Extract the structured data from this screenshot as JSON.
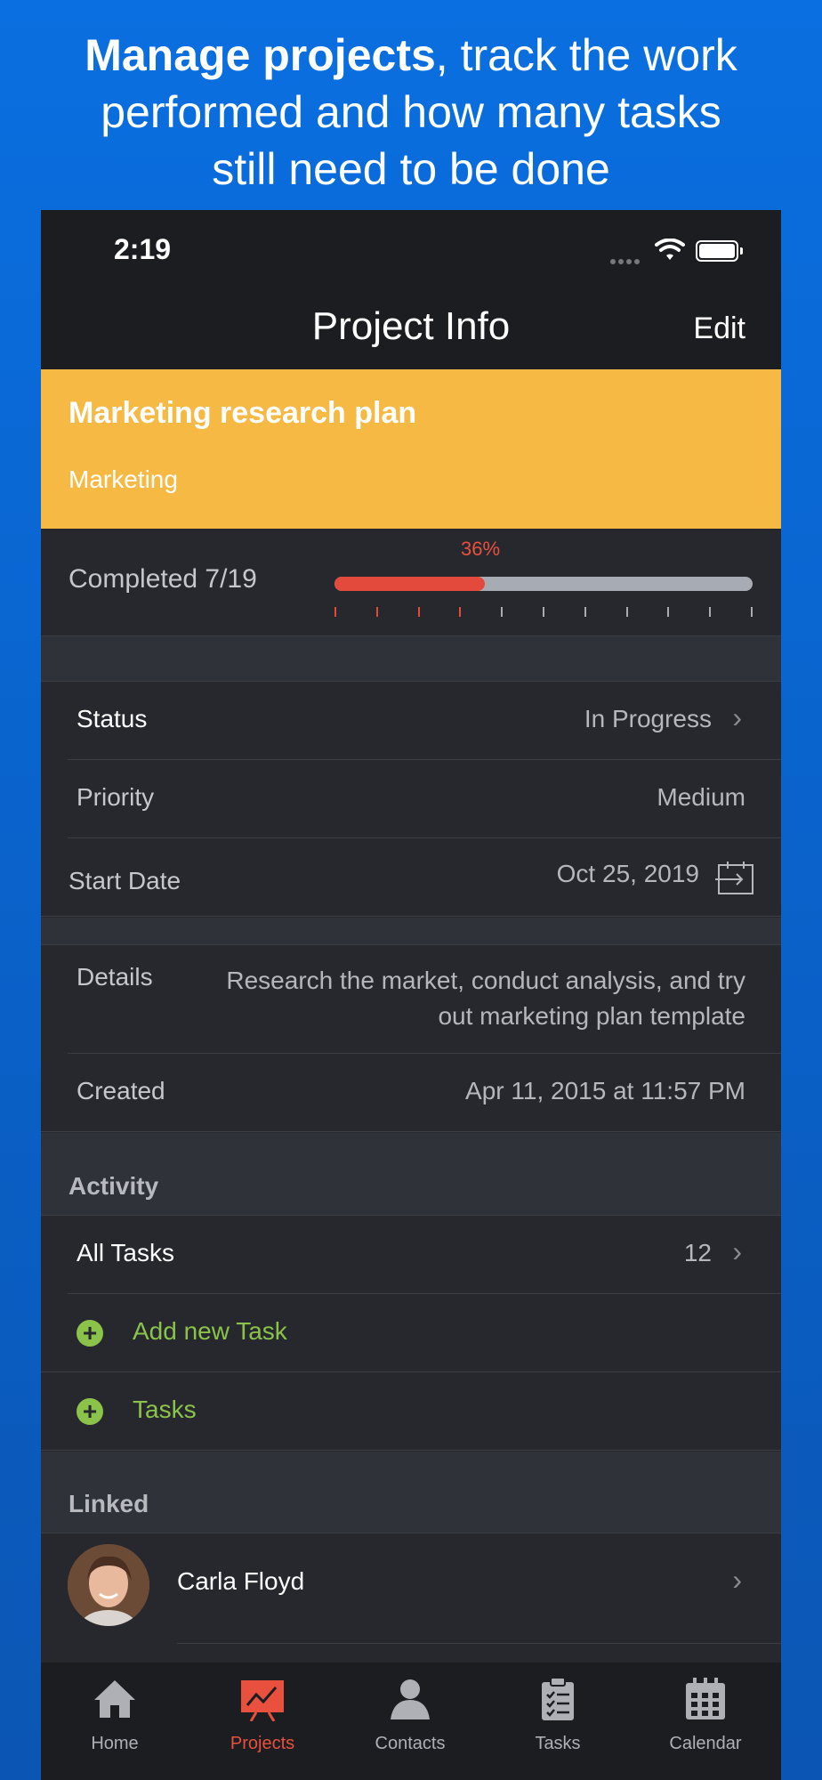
{
  "headline": {
    "bold": "Manage projects",
    "rest_line1": ", track the work",
    "line2": "performed and how many tasks",
    "line3": "still need to be done"
  },
  "status_bar": {
    "time": "2:19"
  },
  "nav": {
    "title": "Project Info",
    "edit": "Edit"
  },
  "project": {
    "title": "Marketing research plan",
    "category": "Marketing",
    "banner_color": "#f6b944",
    "completed_label": "Completed 7/19",
    "percent_label": "36%",
    "progress_fraction": 0.36
  },
  "fields": {
    "status_label": "Status",
    "status_value": "In Progress",
    "priority_label": "Priority",
    "priority_value": "Medium",
    "start_label": "Start Date",
    "start_value": "Oct 25, 2019",
    "details_label": "Details",
    "details_line1": "Research the market, conduct analysis, and try",
    "details_line2": "out marketing plan template",
    "created_label": "Created",
    "created_value": "Apr 11, 2015 at 11:57 PM"
  },
  "activity": {
    "header": "Activity",
    "all_tasks_label": "All Tasks",
    "all_tasks_count": "12",
    "add_task": "Add new Task",
    "tasks": "Tasks"
  },
  "linked": {
    "header": "Linked",
    "contact_name": "Carla Floyd"
  },
  "tabs": {
    "home": "Home",
    "projects": "Projects",
    "contacts": "Contacts",
    "tasks": "Tasks",
    "calendar": "Calendar",
    "active_color": "#e9503e"
  }
}
